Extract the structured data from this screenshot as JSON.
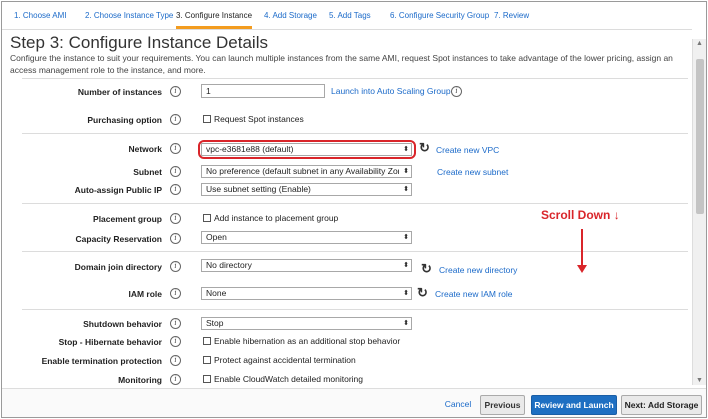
{
  "tabs": [
    {
      "label": "1. Choose AMI"
    },
    {
      "label": "2. Choose Instance Type"
    },
    {
      "label": "3. Configure Instance"
    },
    {
      "label": "4. Add Storage"
    },
    {
      "label": "5. Add Tags"
    },
    {
      "label": "6. Configure Security Group"
    },
    {
      "label": "7. Review"
    }
  ],
  "page": {
    "title": "Step 3: Configure Instance Details",
    "description": "Configure the instance to suit your requirements. You can launch multiple instances from the same AMI, request Spot instances to take advantage of the lower pricing, assign an access management role to the instance, and more."
  },
  "info_glyph": "i",
  "refresh_glyph": "↻",
  "select_arrow": "⬍",
  "fields": {
    "num_instances": {
      "label": "Number of instances",
      "value": "1",
      "link": "Launch into Auto Scaling Group"
    },
    "purchasing": {
      "label": "Purchasing option",
      "checkbox": "Request Spot instances"
    },
    "network": {
      "label": "Network",
      "value": "vpc-e3681e88 (default)",
      "link": "Create new VPC"
    },
    "subnet": {
      "label": "Subnet",
      "value": "No preference (default subnet in any Availability Zone)",
      "link": "Create new subnet"
    },
    "public_ip": {
      "label": "Auto-assign Public IP",
      "value": "Use subnet setting (Enable)"
    },
    "placement": {
      "label": "Placement group",
      "checkbox": "Add instance to placement group"
    },
    "capacity": {
      "label": "Capacity Reservation",
      "value": "Open"
    },
    "domain": {
      "label": "Domain join directory",
      "value": "No directory",
      "link": "Create new directory"
    },
    "iam": {
      "label": "IAM role",
      "value": "None",
      "link": "Create new IAM role"
    },
    "shutdown": {
      "label": "Shutdown behavior",
      "value": "Stop"
    },
    "hibernate": {
      "label": "Stop - Hibernate behavior",
      "checkbox": "Enable hibernation as an additional stop behavior"
    },
    "termination": {
      "label": "Enable termination protection",
      "checkbox": "Protect against accidental termination"
    },
    "monitoring": {
      "label": "Monitoring",
      "checkbox": "Enable CloudWatch detailed monitoring"
    }
  },
  "annotation": {
    "text": "Scroll Down",
    "arrow": "↓"
  },
  "footer": {
    "cancel": "Cancel",
    "previous": "Previous",
    "review_launch": "Review and Launch",
    "next": "Next: Add Storage"
  },
  "colors": {
    "accent": "#1e6fc2",
    "highlight": "#d9252a",
    "active_tab": "#f39c1f"
  }
}
